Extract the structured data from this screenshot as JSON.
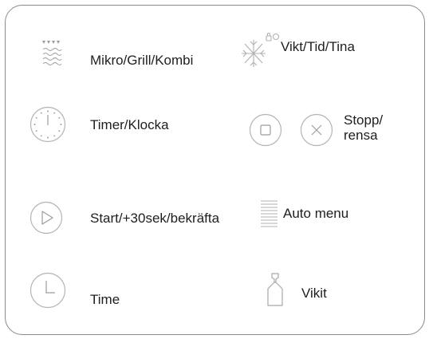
{
  "panel": {
    "buttons": [
      {
        "id": "mikro",
        "label": "Mikro/Grill/Kombi",
        "icon": "microwave-grill-icon"
      },
      {
        "id": "vikt",
        "label": "Vikt/Tid/Tina",
        "icon": "snowflake-defrost-icon"
      },
      {
        "id": "timer",
        "label": "Timer/Klocka",
        "icon": "timer-clock-icon"
      },
      {
        "id": "stopp",
        "label_line1": "Stopp/",
        "label_line2": "rensa",
        "icons": [
          "stop-square-icon",
          "clear-x-icon"
        ]
      },
      {
        "id": "start",
        "label": "Start/+30sek/bekräfta",
        "icon": "play-icon"
      },
      {
        "id": "auto",
        "label": "Auto menu",
        "icon": "list-menu-icon"
      },
      {
        "id": "time",
        "label": "Time",
        "icon": "clock-icon"
      },
      {
        "id": "vikit",
        "label": "Vikit",
        "icon": "weight-icon"
      }
    ]
  }
}
